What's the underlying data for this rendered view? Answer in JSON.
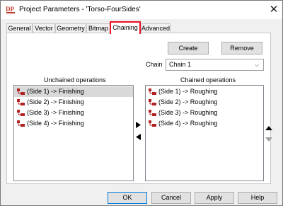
{
  "window": {
    "title": "Project Parameters - 'Torso-FourSides'",
    "app_icon_text": "DP",
    "close_glyph": "✕"
  },
  "tabs": [
    {
      "label": "General",
      "active": false
    },
    {
      "label": "Vector",
      "active": false
    },
    {
      "label": "Geometry",
      "active": false
    },
    {
      "label": "Bitmap",
      "active": false
    },
    {
      "label": "Chaining",
      "active": true
    },
    {
      "label": "Advanced",
      "active": false
    }
  ],
  "chaining": {
    "create_label": "Create",
    "remove_label": "Remove",
    "chain_label": "Chain",
    "chain_value": "Chain 1",
    "unchained_header": "Unchained operations",
    "chained_header": "Chained operations",
    "unchained_items": [
      {
        "label": "(Side 1) -> Finishing",
        "selected": true
      },
      {
        "label": "(Side 2) -> Finishing",
        "selected": false
      },
      {
        "label": "(Side 3) -> Finishing",
        "selected": false
      },
      {
        "label": "(Side 4) -> Finishing",
        "selected": false
      }
    ],
    "chained_items": [
      {
        "label": "(Side 1) -> Roughing"
      },
      {
        "label": "(Side 2) -> Roughing"
      },
      {
        "label": "(Side 3) -> Roughing"
      },
      {
        "label": "(Side 4) -> Roughing"
      }
    ],
    "move_right_icon": "triangle-right-icon",
    "move_left_icon": "triangle-left-icon",
    "move_up_icon": "triangle-up-icon",
    "move_down_icon": "triangle-down-icon"
  },
  "footer": {
    "ok_label": "OK",
    "cancel_label": "Cancel",
    "apply_label": "Apply",
    "help_label": "Help"
  },
  "colors": {
    "active_tab_highlight": "#e81123",
    "selected_row": "#d9d9d9",
    "operation_icon": "#b22222"
  }
}
